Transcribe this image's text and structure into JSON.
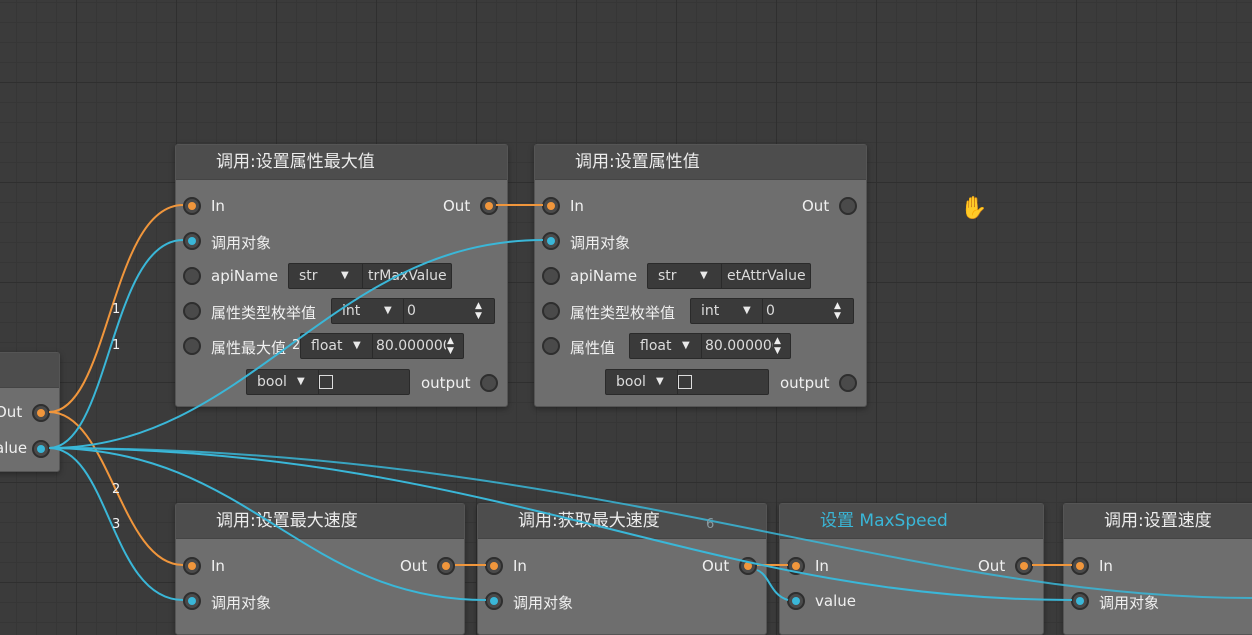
{
  "left_node": {
    "out_label": "Out",
    "value_label": "alue"
  },
  "node1": {
    "title": "调用:设置属性最大值",
    "in_label": "In",
    "out_label": "Out",
    "target_label": "调用对象",
    "apiname_label": "apiName",
    "apiname_type": "str",
    "apiname_value": "trMaxValue",
    "enum_label": "属性类型枚举值",
    "enum_type": "int",
    "enum_value": "0",
    "max_label": "属性最大值",
    "max_type": "float",
    "max_value": "80.000000",
    "output_type": "bool",
    "output_label": "output"
  },
  "node2": {
    "title": "调用:设置属性值",
    "in_label": "In",
    "out_label": "Out",
    "target_label": "调用对象",
    "apiname_label": "apiName",
    "apiname_type": "str",
    "apiname_value": "etAttrValue",
    "enum_label": "属性类型枚举值",
    "enum_type": "int",
    "enum_value": "0",
    "val_label": "属性值",
    "val_type": "float",
    "val_value": "80.000000",
    "output_type": "bool",
    "output_label": "output"
  },
  "node3": {
    "title": "调用:设置最大速度",
    "in_label": "In",
    "out_label": "Out",
    "target_label": "调用对象"
  },
  "node4": {
    "title": "调用:获取最大速度",
    "in_label": "In",
    "out_label": "Out",
    "target_label": "调用对象"
  },
  "node5": {
    "title": "设置 MaxSpeed",
    "in_label": "In",
    "out_label": "Out",
    "value_label": "value"
  },
  "node6": {
    "title": "调用:设置速度",
    "in_label": "In",
    "target_label": "调用对象"
  },
  "wire_numbers": {
    "n1a": "1",
    "n1b": "1",
    "n2": "2",
    "n3": "3",
    "n2b": "2",
    "n6": "6"
  },
  "colors": {
    "exec": "#f0963c",
    "data": "#3ab7d8",
    "node_body": "#6e6e6e",
    "node_header": "#4d4d4d"
  }
}
